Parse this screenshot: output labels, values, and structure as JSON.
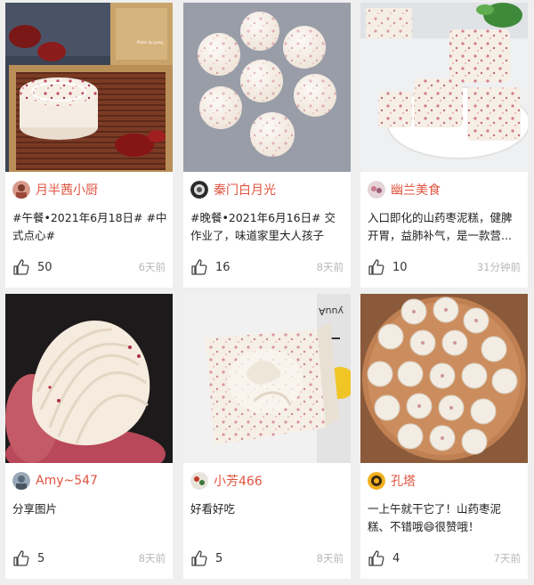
{
  "cards": [
    {
      "author": "月半茜小厨",
      "description": "#午餐•2021年6月18日# #中式点心#",
      "likes": "50",
      "time": "6天前",
      "photo_watermark": "Photo by pang"
    },
    {
      "author": "秦门白月光",
      "description": "#晚餐•2021年6月16日# 交作业了，味道家里大人孩子都...",
      "likes": "16",
      "time": "8天前"
    },
    {
      "author": "幽兰美食",
      "description": "入口即化的山药枣泥糕，健脾开胃，益肺补气，是一款营...",
      "likes": "10",
      "time": "31分钟前"
    },
    {
      "author": "Amy~547",
      "description": "分享图片",
      "likes": "5",
      "time": "8天前"
    },
    {
      "author": "小芳466",
      "description": "好看好吃",
      "likes": "5",
      "time": "8天前",
      "photo_text": "yuuA"
    },
    {
      "author": "孔塔",
      "description": "一上午就干它了！山药枣泥糕、不错哦😄很赞哦！",
      "likes": "4",
      "time": "7天前"
    }
  ],
  "icons": {
    "like": "thumbs-up-icon"
  },
  "colors": {
    "author": "#e0533f",
    "time": "#b7b7b7",
    "text": "#222222",
    "background": "#efefef"
  }
}
